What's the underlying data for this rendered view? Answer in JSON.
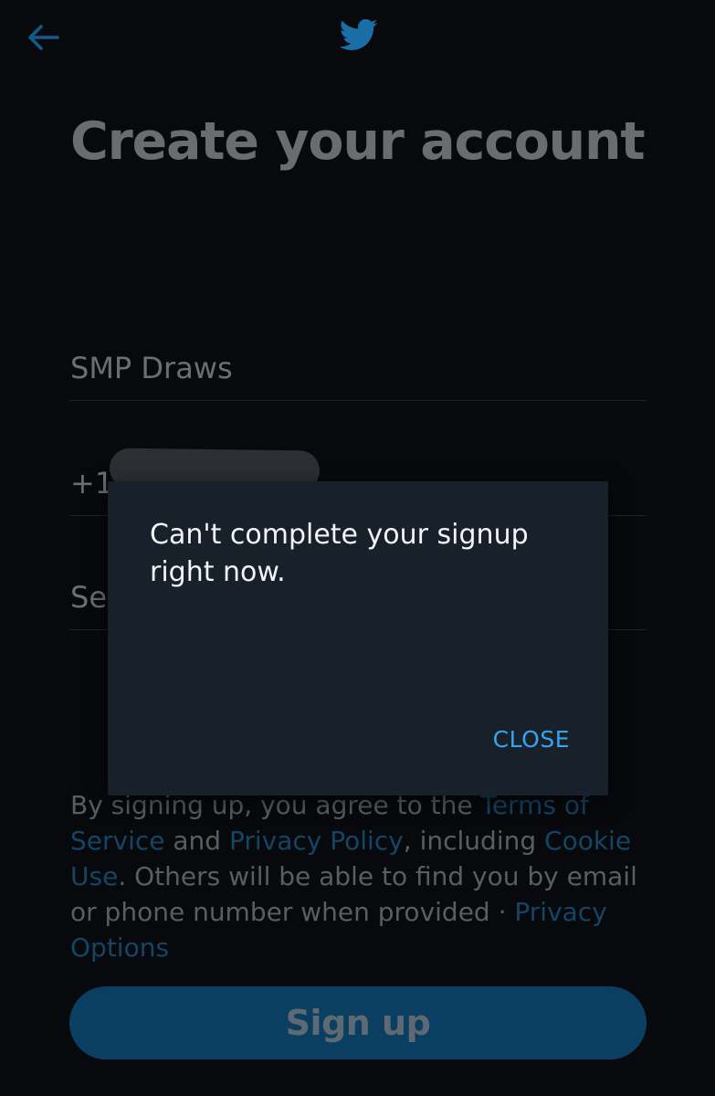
{
  "header": {
    "back_icon": "arrow-left-icon",
    "logo_icon": "twitter-bird-icon",
    "accent_color": "#1d9bf0"
  },
  "form": {
    "title": "Create your account",
    "name_value": "SMP Draws",
    "phone_prefix": "+1",
    "third_field_partial": "Se"
  },
  "legal": {
    "prefix": "By signing up, you agree to the ",
    "terms_link": "Terms of Service",
    "and": " and ",
    "privacy_link": "Privacy Policy",
    "including": ", including ",
    "cookie_link": "Cookie Use",
    "others": ". Others will be able to find you by email or phone number when provided · ",
    "privacy_options_link": "Privacy Options"
  },
  "signup_button": {
    "label": "Sign up"
  },
  "dialog": {
    "message": "Can't complete your signup right now.",
    "close_label": "CLOSE",
    "close_color": "#3aa3ee"
  }
}
